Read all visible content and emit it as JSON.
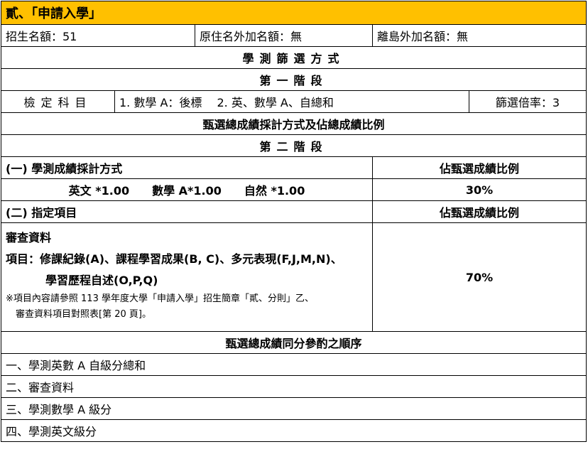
{
  "title": "貳、「申請入學」",
  "quota": {
    "enrollment": "招生名額：51",
    "indigenous": "原住名外加名額：無",
    "island": "離島外加名額：無"
  },
  "screening_header": "學測篩選方式",
  "stage1": {
    "header": "第一階段",
    "subject_label": "檢定科目",
    "subjects": "1. 數學 A：後標　 2. 英、數學 A、自總和",
    "ratio": "篩選倍率：3"
  },
  "score_method_header": "甄選總成績採計方式及佔總成績比例",
  "stage2": {
    "header": "第二階段",
    "section1_label": "(一) 學測成績採計方式",
    "section1_ratio_header": "佔甄選成績比例",
    "scores": [
      "英文 *1.00",
      "數學 A*1.00",
      "自然 *1.00"
    ],
    "section1_ratio": "30%",
    "section2_label": "(二) 指定項目",
    "section2_ratio_header": "佔甄選成績比例",
    "review_title": "審查資料",
    "review_items_1": "項目：修課紀錄(A)、課程學習成果(B, C)、多元表現(F,J,M,N)、",
    "review_items_2": "學習歷程自述(O,P,Q)",
    "review_note_1": "※項目內容請參照 113 學年度大學「申請入學」招生簡章「貳、分則」乙、",
    "review_note_2": "審查資料項目對照表[第 20 頁]。",
    "section2_ratio": "70%"
  },
  "tiebreak": {
    "header": "甄選總成績同分參酌之順序",
    "items": [
      "一、學測英數 A 自級分總和",
      "二、審查資料",
      "三、學測數學 A 級分",
      "四、學測英文級分"
    ]
  }
}
